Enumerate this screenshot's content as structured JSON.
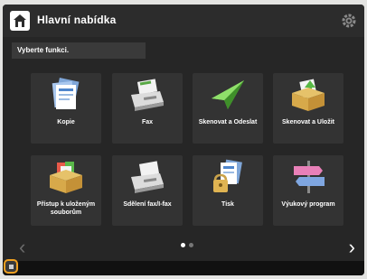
{
  "header": {
    "title": "Hlavní nabídka"
  },
  "prompt": "Vyberte funkci.",
  "tiles": [
    {
      "label": "Kopie",
      "icon": "copy-icon"
    },
    {
      "label": "Fax",
      "icon": "fax-icon"
    },
    {
      "label": "Skenovat a Odeslat",
      "icon": "scan-send-icon"
    },
    {
      "label": "Skenovat a Uložit",
      "icon": "scan-store-icon"
    },
    {
      "label": "Přístup k uloženým souborům",
      "icon": "stored-files-icon"
    },
    {
      "label": "Sdělení fax/I-fax",
      "icon": "fax-ifax-inbox-icon"
    },
    {
      "label": "Tisk",
      "icon": "print-icon"
    },
    {
      "label": "Výukový program",
      "icon": "tutorial-icon"
    }
  ],
  "pagination": {
    "current": 1,
    "total": 2
  },
  "colors": {
    "background": "#262626",
    "tile": "#333333",
    "status_outline": "#f0a020"
  }
}
